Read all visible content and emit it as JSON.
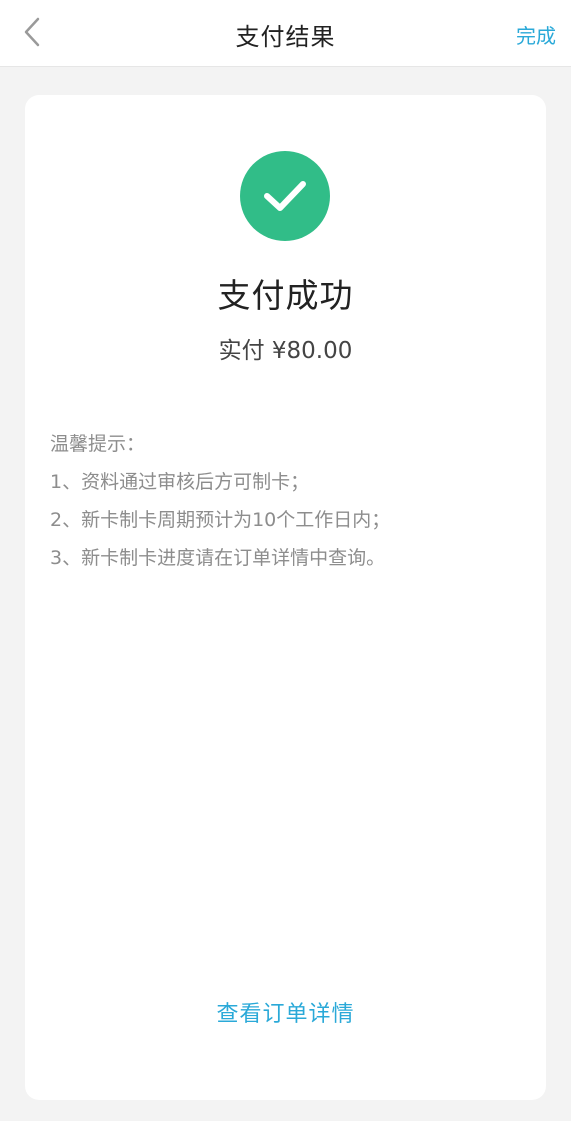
{
  "header": {
    "title": "支付结果",
    "done_label": "完成"
  },
  "result": {
    "status": "支付成功",
    "paid_amount": "实付 ¥80.00",
    "icon": "check-circle-icon",
    "icon_color": "#31bd88"
  },
  "tips": {
    "heading": "温馨提示：",
    "items": [
      "1、资料通过审核后方可制卡；",
      "2、新卡制卡周期预计为10个工作日内；",
      "3、新卡制卡进度请在订单详情中查询。"
    ]
  },
  "actions": {
    "view_order_detail": "查看订单详情"
  },
  "colors": {
    "accent": "#2aa9d8",
    "success": "#31bd88"
  }
}
